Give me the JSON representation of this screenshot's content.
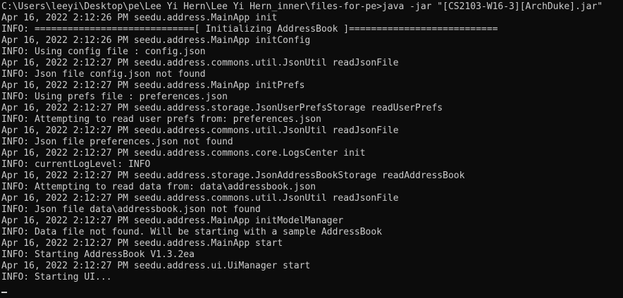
{
  "console": {
    "lines": [
      "C:\\Users\\leeyi\\Desktop\\pe\\Lee Yi Hern\\Lee Yi Hern_inner\\files-for-pe>java -jar \"[CS2103-W16-3][ArchDuke].jar\"",
      "Apr 16, 2022 2:12:26 PM seedu.address.MainApp init",
      "INFO: =============================[ Initializing AddressBook ]===========================",
      "Apr 16, 2022 2:12:26 PM seedu.address.MainApp initConfig",
      "INFO: Using config file : config.json",
      "Apr 16, 2022 2:12:27 PM seedu.address.commons.util.JsonUtil readJsonFile",
      "INFO: Json file config.json not found",
      "Apr 16, 2022 2:12:27 PM seedu.address.MainApp initPrefs",
      "INFO: Using prefs file : preferences.json",
      "Apr 16, 2022 2:12:27 PM seedu.address.storage.JsonUserPrefsStorage readUserPrefs",
      "INFO: Attempting to read user prefs from: preferences.json",
      "Apr 16, 2022 2:12:27 PM seedu.address.commons.util.JsonUtil readJsonFile",
      "INFO: Json file preferences.json not found",
      "Apr 16, 2022 2:12:27 PM seedu.address.commons.core.LogsCenter init",
      "INFO: currentLogLevel: INFO",
      "Apr 16, 2022 2:12:27 PM seedu.address.storage.JsonAddressBookStorage readAddressBook",
      "INFO: Attempting to read data from: data\\addressbook.json",
      "Apr 16, 2022 2:12:27 PM seedu.address.commons.util.JsonUtil readJsonFile",
      "INFO: Json file data\\addressbook.json not found",
      "Apr 16, 2022 2:12:27 PM seedu.address.MainApp initModelManager",
      "INFO: Data file not found. Will be starting with a sample AddressBook",
      "Apr 16, 2022 2:12:27 PM seedu.address.MainApp start",
      "INFO: Starting AddressBook V1.3.2ea",
      "Apr 16, 2022 2:12:27 PM seedu.address.ui.UiManager start",
      "INFO: Starting UI..."
    ]
  },
  "colors": {
    "background": "#0c0c0c",
    "foreground": "#cccccc"
  }
}
